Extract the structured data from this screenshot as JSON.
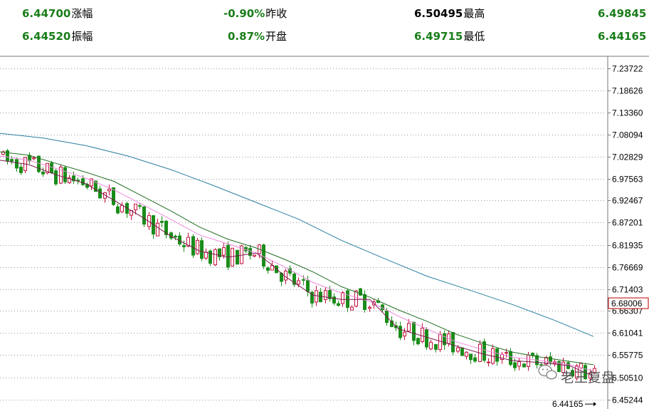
{
  "header": {
    "row1": [
      {
        "value": "6.44700",
        "label": "涨幅",
        "value_color": "#1a7d1a"
      },
      {
        "value": "-0.90%",
        "label": "昨收",
        "value_color": "#1a7d1a"
      },
      {
        "value": "6.50495",
        "label": "最高",
        "value_color": "#000000"
      },
      {
        "value": "6.49845",
        "label": "",
        "value_color": "#1a7d1a"
      }
    ],
    "row2": [
      {
        "value": "6.44520",
        "label": "振幅",
        "value_color": "#1a7d1a"
      },
      {
        "value": "0.87%",
        "label": "开盘",
        "value_color": "#1a7d1a"
      },
      {
        "value": "6.49715",
        "label": "最低",
        "value_color": "#1a7d1a"
      },
      {
        "value": "6.44165",
        "label": "",
        "value_color": "#1a7d1a"
      }
    ]
  },
  "watermark": {
    "text": "老王复盘"
  },
  "colors": {
    "up": "#c0143c",
    "down": "#1a8c1a",
    "ma5": "#7a1a50",
    "ma10": "#ee88dd",
    "ma20": "#206e20",
    "ma60": "#2a7fa0",
    "grid": "#999999",
    "current_box": "#c00000"
  },
  "chart_data": {
    "type": "candlestick",
    "y_ticks": [
      "7.23722",
      "7.18626",
      "7.13360",
      "7.08094",
      "7.02829",
      "6.97563",
      "6.92467",
      "6.87201",
      "6.81935",
      "6.76669",
      "6.71403",
      "6.66307",
      "6.61041",
      "6.55775",
      "6.50510",
      "6.45244"
    ],
    "ylim": [
      6.43,
      7.265
    ],
    "current_price_label": "6.68006",
    "current_price": 6.68006,
    "low_marker_label": "6.44165",
    "low_marker_value": 6.44165,
    "grid": true,
    "series": [
      {
        "name": "MA60",
        "style": "line",
        "values": [
          [
            0,
            7.084
          ],
          [
            60,
            7.073
          ],
          [
            120,
            7.055
          ],
          [
            180,
            7.03
          ],
          [
            240,
            6.998
          ],
          [
            300,
            6.96
          ],
          [
            360,
            6.92
          ],
          [
            420,
            6.88
          ],
          [
            480,
            6.83
          ],
          [
            540,
            6.787
          ],
          [
            600,
            6.745
          ],
          [
            660,
            6.712
          ],
          [
            720,
            6.678
          ],
          [
            780,
            6.64
          ],
          [
            834,
            6.602
          ]
        ]
      },
      {
        "name": "MA20",
        "style": "line",
        "values": [
          [
            0,
            7.04
          ],
          [
            40,
            7.032
          ],
          [
            80,
            7.012
          ],
          [
            120,
            6.992
          ],
          [
            160,
            6.97
          ],
          [
            200,
            6.935
          ],
          [
            240,
            6.9
          ],
          [
            280,
            6.862
          ],
          [
            320,
            6.833
          ],
          [
            360,
            6.812
          ],
          [
            400,
            6.785
          ],
          [
            440,
            6.755
          ],
          [
            480,
            6.72
          ],
          [
            520,
            6.695
          ],
          [
            560,
            6.665
          ],
          [
            600,
            6.638
          ],
          [
            640,
            6.608
          ],
          [
            680,
            6.585
          ],
          [
            720,
            6.565
          ],
          [
            760,
            6.553
          ],
          [
            800,
            6.543
          ],
          [
            834,
            6.535
          ]
        ]
      },
      {
        "name": "MA10",
        "style": "line",
        "values": [
          [
            0,
            7.03
          ],
          [
            40,
            7.02
          ],
          [
            80,
            7.0
          ],
          [
            120,
            6.978
          ],
          [
            160,
            6.95
          ],
          [
            200,
            6.915
          ],
          [
            240,
            6.88
          ],
          [
            280,
            6.843
          ],
          [
            320,
            6.822
          ],
          [
            360,
            6.8
          ],
          [
            400,
            6.767
          ],
          [
            440,
            6.73
          ],
          [
            480,
            6.705
          ],
          [
            520,
            6.685
          ],
          [
            560,
            6.65
          ],
          [
            600,
            6.62
          ],
          [
            640,
            6.59
          ],
          [
            680,
            6.57
          ],
          [
            720,
            6.553
          ],
          [
            760,
            6.545
          ],
          [
            800,
            6.535
          ],
          [
            834,
            6.52
          ]
        ]
      },
      {
        "name": "MA5",
        "style": "line",
        "values": [
          [
            0,
            7.02
          ],
          [
            40,
            7.01
          ],
          [
            80,
            6.985
          ],
          [
            120,
            6.965
          ],
          [
            160,
            6.925
          ],
          [
            200,
            6.885
          ],
          [
            240,
            6.84
          ],
          [
            280,
            6.805
          ],
          [
            320,
            6.79
          ],
          [
            360,
            6.8
          ],
          [
            380,
            6.775
          ],
          [
            400,
            6.745
          ],
          [
            440,
            6.7
          ],
          [
            480,
            6.69
          ],
          [
            520,
            6.69
          ],
          [
            560,
            6.62
          ],
          [
            600,
            6.6
          ],
          [
            640,
            6.58
          ],
          [
            680,
            6.56
          ],
          [
            720,
            6.545
          ],
          [
            760,
            6.54
          ],
          [
            800,
            6.533
          ],
          [
            834,
            6.508
          ]
        ]
      }
    ]
  }
}
